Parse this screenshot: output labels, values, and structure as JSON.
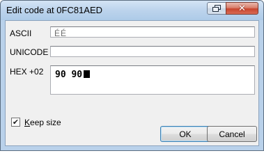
{
  "window": {
    "title": "Edit code at 0FC81AED",
    "restore_icon": "restore-icon",
    "close_icon": "close-icon"
  },
  "fields": {
    "ascii": {
      "label": "ASCII",
      "value": "ÉÉ"
    },
    "unicode": {
      "label": "UNICODE",
      "value": ""
    },
    "hex": {
      "label": "HEX +02",
      "value": "90 90"
    }
  },
  "options": {
    "keep_size": {
      "label": "Keep size",
      "checked": true
    }
  },
  "buttons": {
    "ok": "OK",
    "cancel": "Cancel"
  },
  "colors": {
    "frame": "#b9d1ea",
    "client": "#f0f0f0",
    "close_button": "#c8452e"
  }
}
